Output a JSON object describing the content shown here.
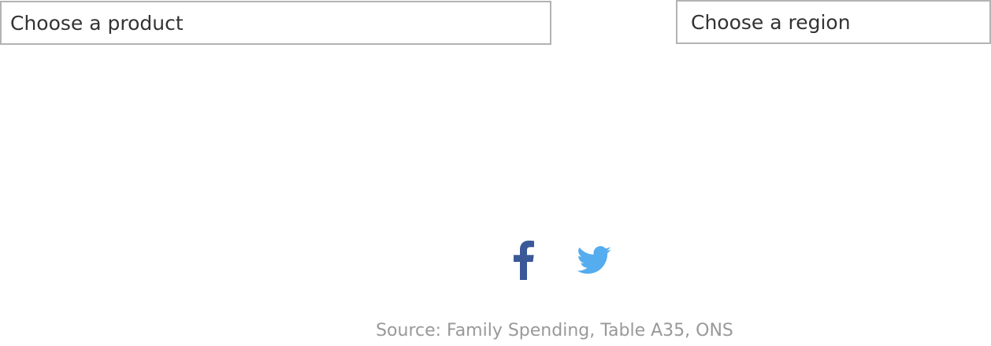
{
  "filters": {
    "product": {
      "label": "Choose a product"
    },
    "region": {
      "label": "Choose a region"
    }
  },
  "share": {
    "facebook_icon": "facebook-icon",
    "twitter_icon": "twitter-icon",
    "facebook_color": "#3b5998",
    "twitter_color": "#55acee"
  },
  "footer": {
    "source": "Source: Family Spending, Table A35, ONS"
  }
}
